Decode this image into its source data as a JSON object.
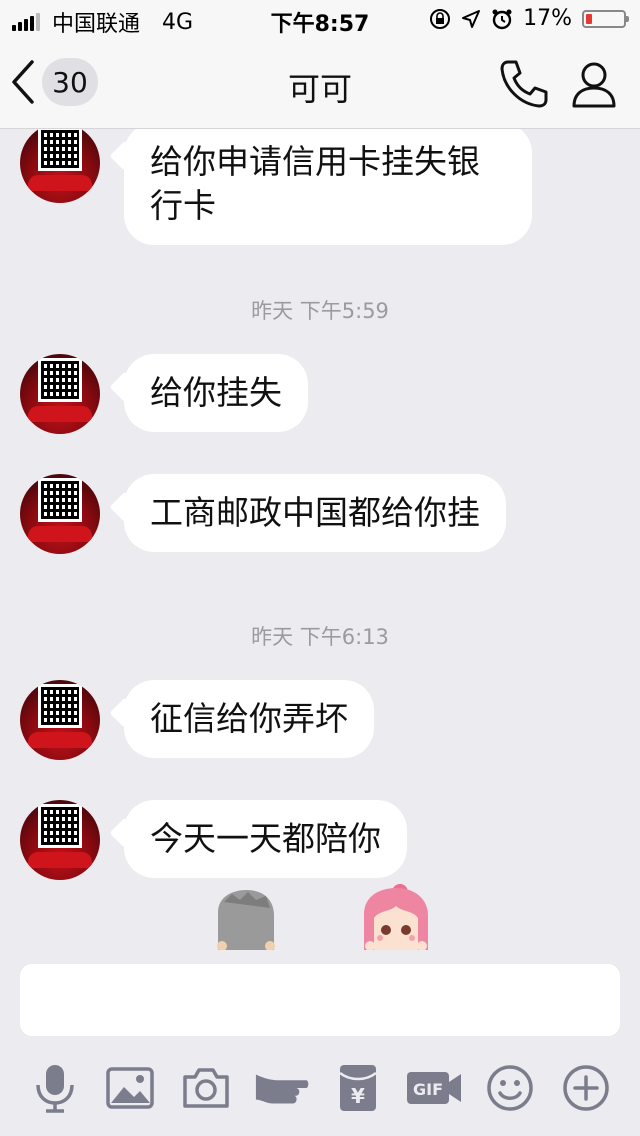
{
  "status_bar": {
    "carrier": "中国联通",
    "network": "4G",
    "time": "下午8:57",
    "battery": "17%",
    "battery_level": 0.17
  },
  "nav": {
    "back_count": "30",
    "title": "可可"
  },
  "messages": [
    {
      "text": "给你申请信用卡挂失银行卡"
    },
    {
      "text": "给你挂失"
    },
    {
      "text": "工商邮政中国都给你挂"
    },
    {
      "text": "征信给你弄坏"
    },
    {
      "text": "今天一天都陪你"
    }
  ],
  "timestamps": [
    {
      "text": "昨天 下午5:59"
    },
    {
      "text": "昨天 下午6:13"
    }
  ],
  "input": {
    "placeholder": "",
    "value": ""
  },
  "toolbar": {
    "icons": [
      "microphone-icon",
      "image-icon",
      "camera-icon",
      "poke-icon",
      "red-packet-icon",
      "gif-icon",
      "emoji-icon",
      "plus-icon"
    ],
    "gif_label": "GIF",
    "yuan_label": "¥"
  },
  "colors": {
    "background": "#ebebf0",
    "bubble": "#ffffff",
    "battery_low": "#e53935",
    "toolbar_icon": "#7b7d8c"
  }
}
